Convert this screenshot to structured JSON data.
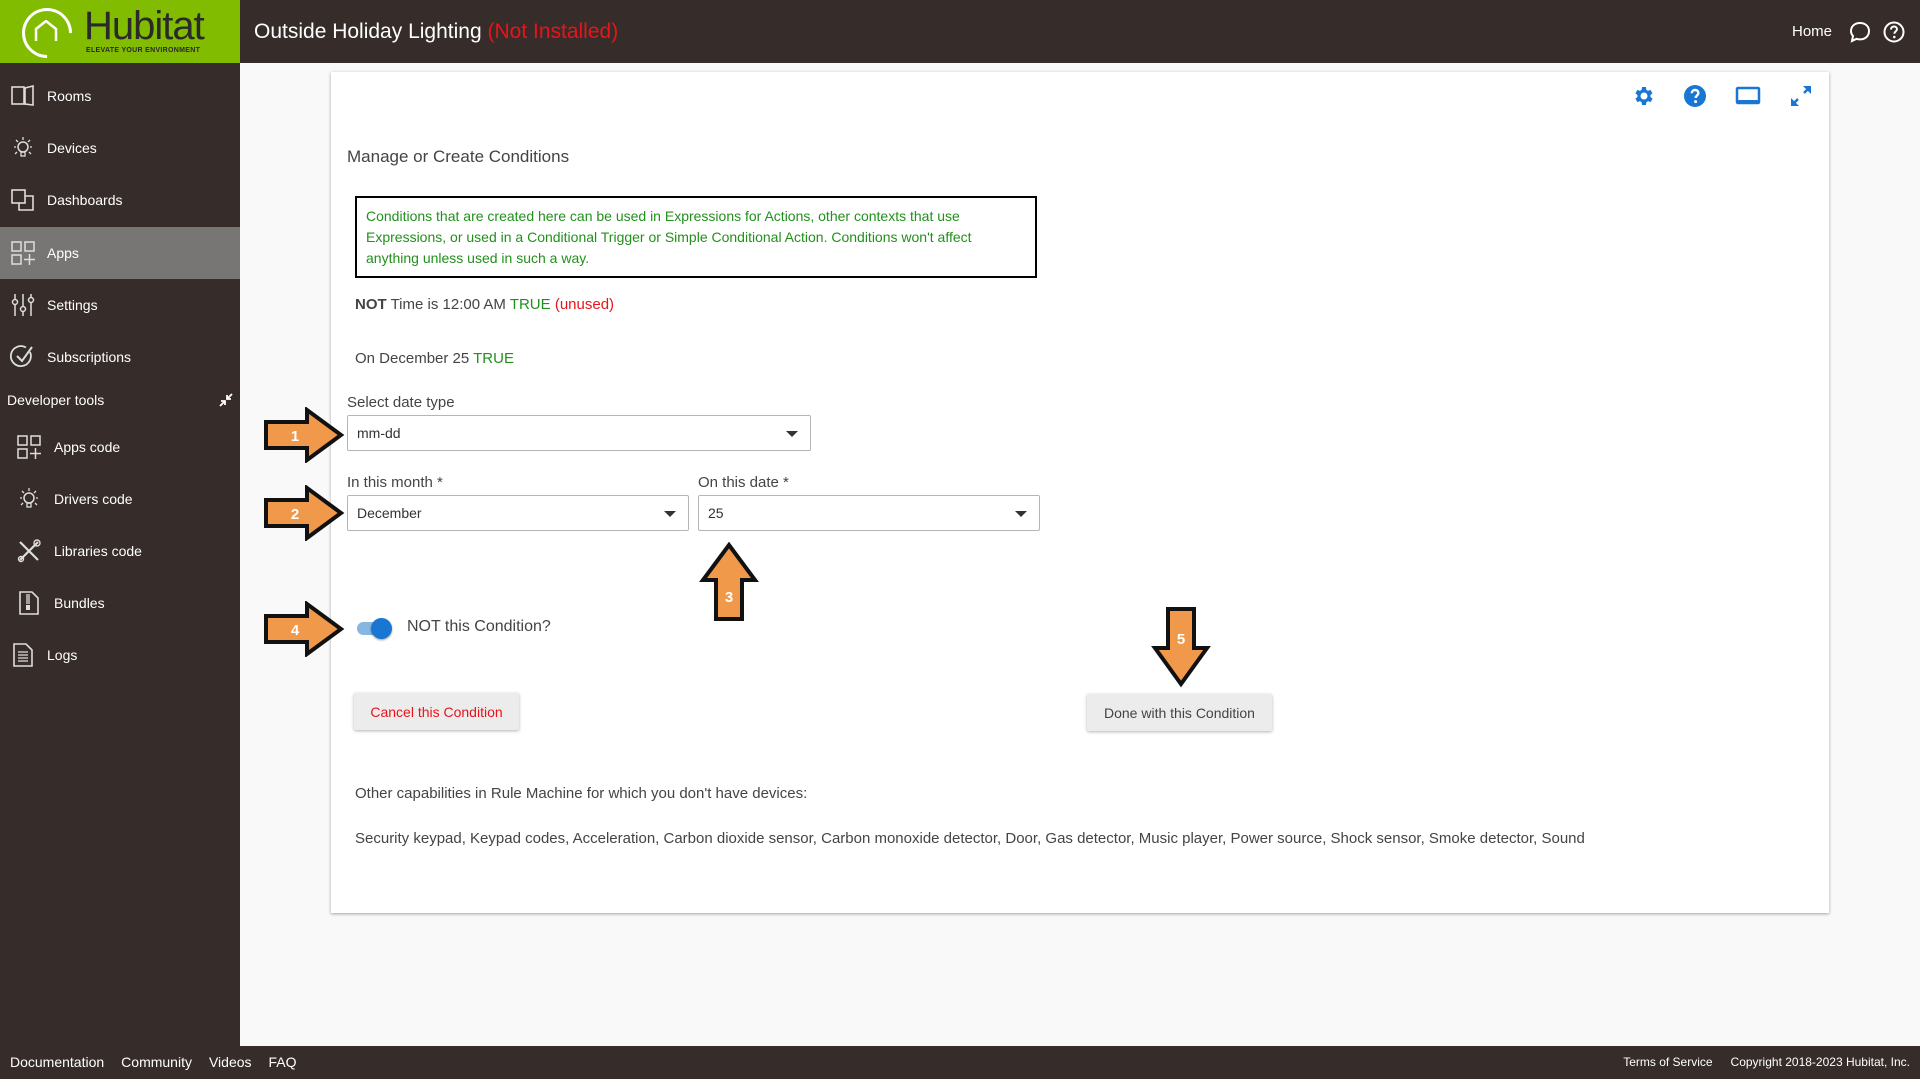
{
  "header": {
    "logo_word": "Hubitat",
    "logo_tagline": "ELEVATE YOUR ENVIRONMENT",
    "title": "Outside Holiday Lighting",
    "status": "(Not Installed)",
    "home_label": "Home",
    "icons": [
      "chat-icon",
      "help-circle-icon"
    ]
  },
  "sidebar": {
    "items": [
      {
        "label": "Rooms",
        "icon": "rooms-icon"
      },
      {
        "label": "Devices",
        "icon": "lightbulb-icon"
      },
      {
        "label": "Dashboards",
        "icon": "dashboards-icon"
      },
      {
        "label": "Apps",
        "icon": "apps-icon",
        "active": true
      },
      {
        "label": "Settings",
        "icon": "sliders-icon"
      },
      {
        "label": "Subscriptions",
        "icon": "check-circle-icon"
      }
    ],
    "dev_tools_label": "Developer tools",
    "dev_items": [
      {
        "label": "Apps code",
        "icon": "apps-icon"
      },
      {
        "label": "Drivers code",
        "icon": "lightbulb-icon"
      },
      {
        "label": "Libraries code",
        "icon": "tools-icon"
      },
      {
        "label": "Bundles",
        "icon": "zip-file-icon"
      },
      {
        "label": "Logs",
        "icon": "document-icon"
      }
    ]
  },
  "card": {
    "toolbar_icons": [
      "gear-icon",
      "help-icon",
      "monitor-icon",
      "fullscreen-icon"
    ],
    "heading": "Manage or Create Conditions",
    "info_text": "Conditions that are created here can be used in Expressions for Actions, other contexts that use Expressions, or used in a Conditional Trigger or Simple Conditional Action.  Conditions won't affect anything unless used in such a way.",
    "conditions": [
      {
        "prefix": "NOT",
        "text": "Time is 12:00 AM",
        "state": "TRUE",
        "note": "(unused)"
      },
      {
        "prefix": "",
        "text": "On December 25",
        "state": "TRUE",
        "note": ""
      }
    ],
    "date_type": {
      "label": "Select date type",
      "value": "mm-dd"
    },
    "month": {
      "label": "In this month *",
      "value": "December"
    },
    "date": {
      "label": "On this date *",
      "value": "25"
    },
    "not_toggle": {
      "label": "NOT this Condition?",
      "checked": true
    },
    "cancel_label": "Cancel this Condition",
    "done_label": "Done with this Condition",
    "other_caps_label": "Other capabilities in Rule Machine for which you don't have devices:",
    "other_caps_list": "Security keypad, Keypad codes, Acceleration, Carbon dioxide sensor, Carbon monoxide detector, Door, Gas detector, Music player, Power source, Shock sensor, Smoke detector, Sound"
  },
  "annotations": {
    "arrow_labels": [
      "1",
      "2",
      "3",
      "4",
      "5"
    ],
    "arrow_color": "#f0994a"
  },
  "footer": {
    "links": [
      "Documentation",
      "Community",
      "Videos",
      "FAQ"
    ],
    "terms": "Terms of Service",
    "copyright": "Copyright 2018-2023 Hubitat, Inc."
  },
  "colors": {
    "brand_green": "#81bc00",
    "header_bg": "#362c2a",
    "accent_blue": "#1976d2",
    "true_green": "#22901c",
    "error_red": "#e8141b"
  }
}
